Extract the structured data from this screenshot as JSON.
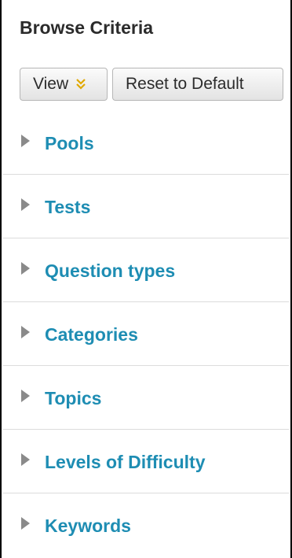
{
  "panel": {
    "title": "Browse Criteria"
  },
  "toolbar": {
    "view_label": "View",
    "reset_label": "Reset to Default"
  },
  "criteria": [
    {
      "label": "Pools"
    },
    {
      "label": "Tests"
    },
    {
      "label": "Question types"
    },
    {
      "label": "Categories"
    },
    {
      "label": "Topics"
    },
    {
      "label": "Levels of Difficulty"
    },
    {
      "label": "Keywords"
    }
  ],
  "colors": {
    "link": "#1e8db3",
    "chevron": "#e0a800",
    "triangle": "#8a8a8a",
    "title": "#2b2b2b"
  },
  "icons": {
    "view_dropdown": "double-chevron-down-icon",
    "expand": "caret-right-icon"
  }
}
